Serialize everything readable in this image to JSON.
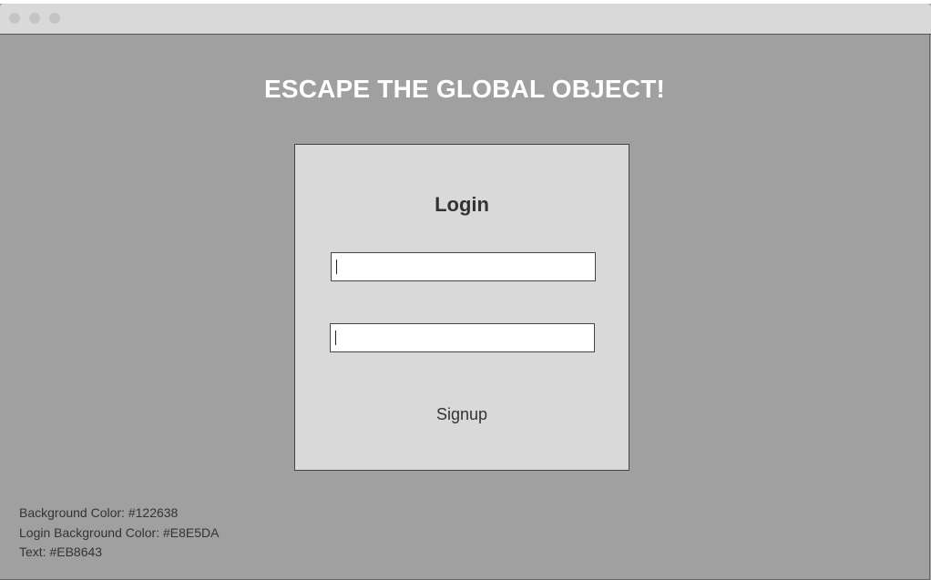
{
  "window": {
    "controls": [
      "close",
      "minimize",
      "maximize"
    ]
  },
  "page": {
    "title": "ESCAPE THE GLOBAL OBJECT!"
  },
  "login": {
    "heading": "Login",
    "username": {
      "value": "",
      "placeholder": ""
    },
    "password": {
      "value": "",
      "placeholder": ""
    },
    "signup_label": "Signup"
  },
  "notes": {
    "background_color": "Background Color: #122638",
    "login_background_color": "Login Background Color: #E8E5DA",
    "text_color": "Text: #EB8643"
  },
  "colors": {
    "background": "#a0a0a0",
    "login_background": "#d9d9d9",
    "title_text": "#ffffff"
  }
}
